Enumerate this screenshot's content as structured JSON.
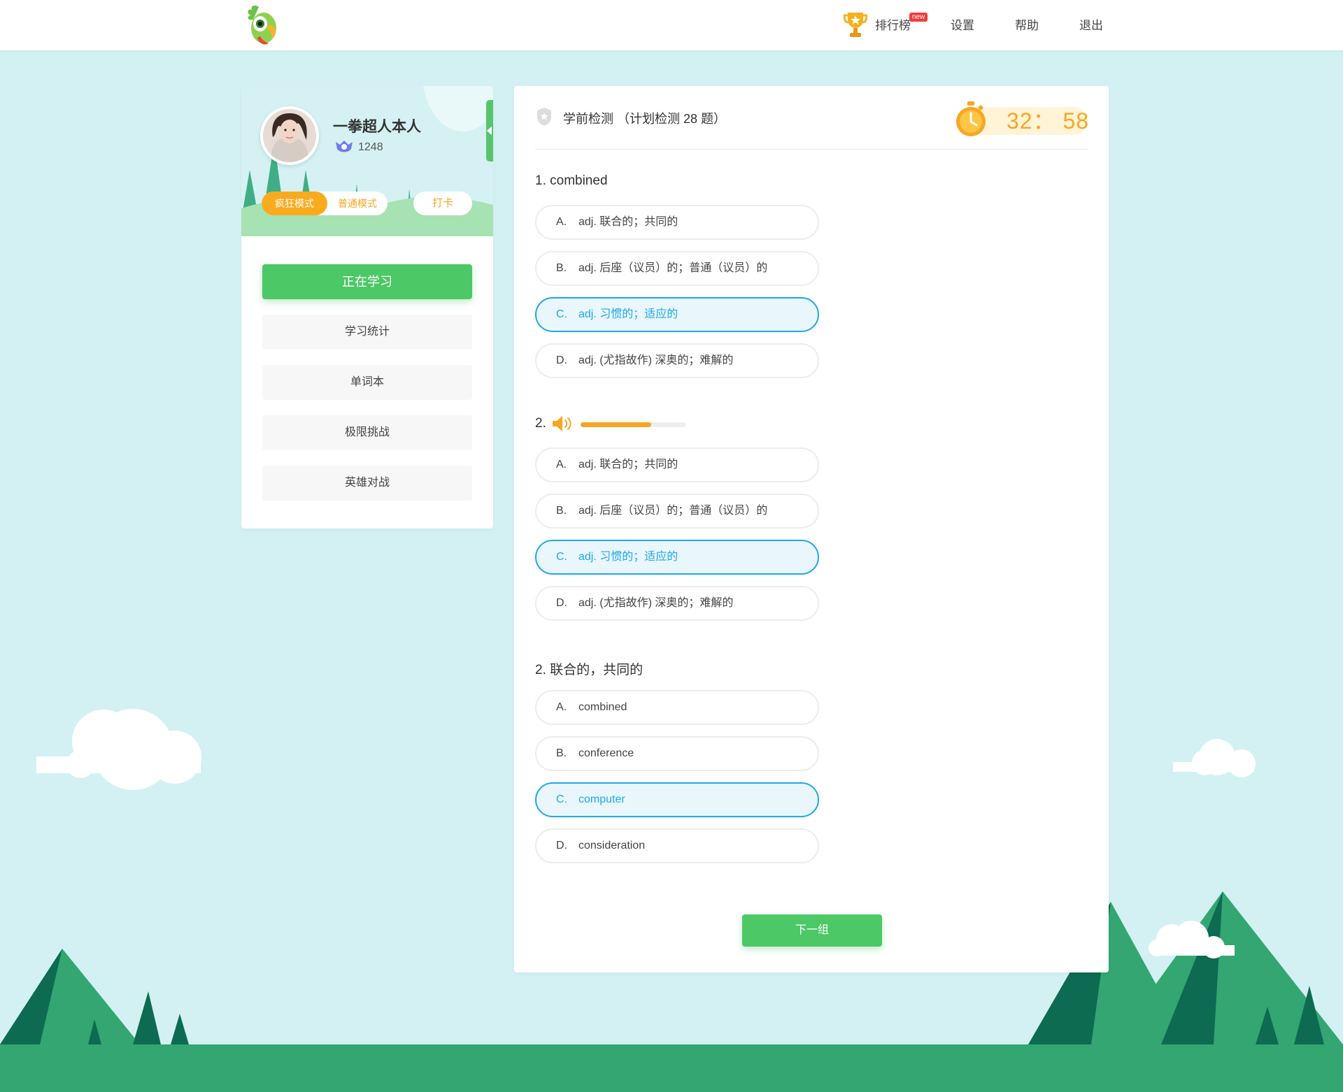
{
  "nav": {
    "ranking_label": "排行榜",
    "new_badge": "new",
    "settings_label": "设置",
    "help_label": "帮助",
    "logout_label": "退出"
  },
  "profile": {
    "username": "一拳超人本人",
    "score": "1248",
    "mode_crazy": "疯狂模式",
    "mode_normal": "普通模式",
    "checkin_label": "打卡"
  },
  "menu": [
    {
      "label": "正在学习",
      "active": true
    },
    {
      "label": "学习统计",
      "active": false
    },
    {
      "label": "单词本",
      "active": false
    },
    {
      "label": "极限挑战",
      "active": false
    },
    {
      "label": "英雄对战",
      "active": false
    }
  ],
  "quiz": {
    "title": "学前检测 （计划检测 28 题）",
    "timer": "32： 58",
    "audio_progress": 0.67,
    "questions": [
      {
        "title": "1. combined",
        "options": [
          {
            "letter": "A.",
            "text": "adj. 联合的；共同的",
            "selected": false
          },
          {
            "letter": "B.",
            "text": "adj. 后座（议员）的；普通（议员）的",
            "selected": false
          },
          {
            "letter": "C.",
            "text": "adj. 习惯的；适应的",
            "selected": true
          },
          {
            "letter": "D.",
            "text": "adj. (尤指故作) 深奥的；难解的",
            "selected": false
          }
        ]
      },
      {
        "title": "2.",
        "options": [
          {
            "letter": "A.",
            "text": "adj. 联合的；共同的",
            "selected": false
          },
          {
            "letter": "B.",
            "text": "adj. 后座（议员）的；普通（议员）的",
            "selected": false
          },
          {
            "letter": "C.",
            "text": "adj. 习惯的；适应的",
            "selected": true
          },
          {
            "letter": "D.",
            "text": "adj. (尤指故作) 深奥的；难解的",
            "selected": false
          }
        ]
      },
      {
        "title": "2. 联合的，共同的",
        "options": [
          {
            "letter": "A.",
            "text": "combined",
            "selected": false
          },
          {
            "letter": "B.",
            "text": "conference",
            "selected": false
          },
          {
            "letter": "C.",
            "text": "computer",
            "selected": true
          },
          {
            "letter": "D.",
            "text": "consideration",
            "selected": false
          }
        ]
      }
    ],
    "next_label": "下一组"
  },
  "colors": {
    "primary_green": "#4cc866",
    "accent_orange": "#f7a623",
    "selected_blue": "#1fa8e8",
    "background": "#d3f1f3"
  },
  "icons": [
    "parrot-logo-icon",
    "trophy-icon",
    "rank-badge-icon",
    "collapse-arrow-icon",
    "shield-icon",
    "stopwatch-icon",
    "speaker-icon"
  ]
}
